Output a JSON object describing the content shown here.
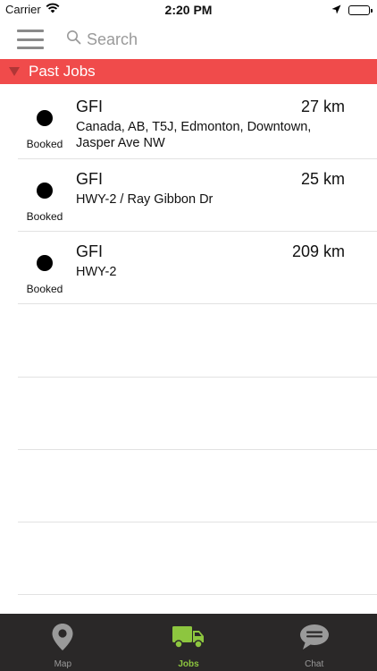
{
  "status_bar": {
    "carrier": "Carrier",
    "time": "2:20 PM"
  },
  "header": {
    "search_placeholder": "Search"
  },
  "section": {
    "title": "Past Jobs"
  },
  "jobs": [
    {
      "title": "GFI",
      "distance": "27 km",
      "address": "Canada, AB, T5J, Edmonton, Downtown, Jasper Ave NW",
      "status": "Booked"
    },
    {
      "title": "GFI",
      "distance": "25 km",
      "address": "HWY-2 / Ray Gibbon Dr",
      "status": "Booked"
    },
    {
      "title": "GFI",
      "distance": "209 km",
      "address": "HWY-2",
      "status": "Booked"
    }
  ],
  "tabs": [
    {
      "label": "Map",
      "icon": "map-pin-icon",
      "active": false
    },
    {
      "label": "Jobs",
      "icon": "truck-icon",
      "active": true
    },
    {
      "label": "Chat",
      "icon": "chat-bubble-icon",
      "active": false
    }
  ],
  "colors": {
    "section_header_bg": "#f04b4b",
    "tab_bar_bg": "#2a2828",
    "active_tab": "#8dc63f",
    "inactive_tab": "#9a9a9a"
  }
}
